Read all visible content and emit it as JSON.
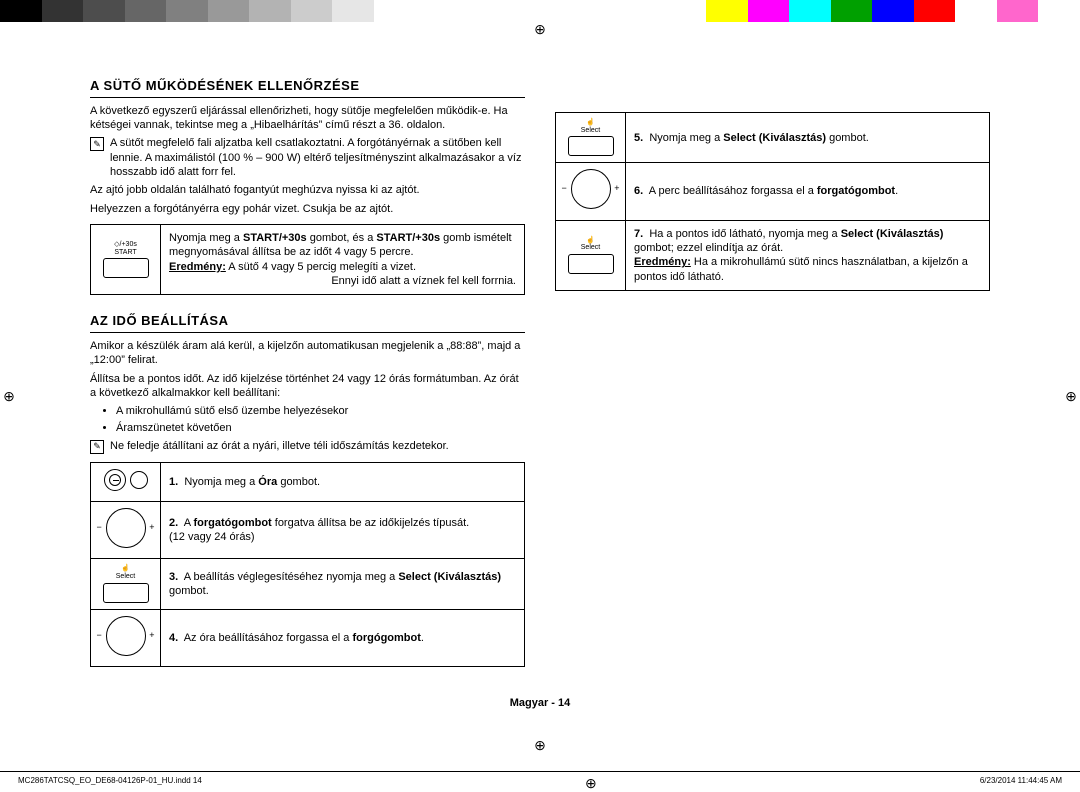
{
  "colorbar": [
    "#000000",
    "#333333",
    "#4d4d4d",
    "#666666",
    "#808080",
    "#999999",
    "#b3b3b3",
    "#cccccc",
    "#e6e6e6",
    "#ffffff",
    "#ffffff",
    "#ffffff",
    "#ffffff",
    "#ffffff",
    "#ffffff",
    "#ffffff",
    "#ffffff",
    "#ffff00",
    "#ff00ff",
    "#00ffff",
    "#00a000",
    "#0000ff",
    "#ff0000",
    "#ffffff",
    "#ff66cc",
    "#ffffff"
  ],
  "reg_glyph": "⊕",
  "section1": {
    "heading": "A SÜTŐ MŰKÖDÉSÉNEK ELLENŐRZÉSE",
    "p1": "A következő egyszerű eljárással ellenőrizheti, hogy sütője megfelelően működik-e. Ha kétségei vannak, tekintse meg a „Hibaelhárítás” című részt a 36. oldalon.",
    "note1": "A sütőt megfelelő fali aljzatba kell csatlakoztatni. A forgótányérnak a sütőben kell lennie. A maximálistól (100 % – 900 W) eltérő teljesítményszint alkalmazásakor a víz hosszabb idő alatt forr fel.",
    "p2": "Az ajtó jobb oldalán található fogantyút meghúzva nyissa ki az ajtót.",
    "p3": "Helyezzen a forgótányérra egy pohár vizet. Csukja be az ajtót.",
    "step_icon_labels": {
      "top": "◇/+30s",
      "bottom": "START"
    },
    "step_text_a": "Nyomja meg a ",
    "step_bold1": "START/+30s",
    "step_text_b": " gombot, és a ",
    "step_bold2": "START/+30s",
    "step_text_c": " gomb ismételt megnyomásával állítsa be az időt 4 vagy 5 percre.",
    "step_res_label": "Eredmény:",
    "step_res_text": " A sütő 4 vagy 5 percig melegíti a vizet.",
    "step_tail": "Ennyi idő alatt a víznek fel kell forrnia."
  },
  "section2": {
    "heading": "AZ IDŐ BEÁLLÍTÁSA",
    "p1": "Amikor a készülék áram alá kerül, a kijelzőn automatikusan megjelenik a „88:88”, majd a „12:00” felirat.",
    "p2": "Állítsa be a pontos időt. Az idő kijelzése történhet 24 vagy 12 órás formátumban. Az órát a következő alkalmakkor kell beállítani:",
    "b1": "A mikrohullámú sütő első üzembe helyezésekor",
    "b2": "Áramszünetet követően",
    "note": "Ne feledje átállítani az órát a nyári, illetve téli időszámítás kezdetekor.",
    "steps": [
      {
        "n": "1.",
        "a": "Nyomja meg a ",
        "bold": "Óra",
        "b": " gombot."
      },
      {
        "n": "2.",
        "a": "A ",
        "bold": "forgatógombot",
        "b": " forgatva állítsa be az időkijelzés típusát.",
        "c": "(12 vagy 24 órás)"
      },
      {
        "n": "3.",
        "a": "A beállítás véglegesítéséhez nyomja meg a ",
        "bold": "Select (Kiválasztás)",
        "b": " gombot."
      },
      {
        "n": "4.",
        "a": "Az óra beállításához forgassa el a ",
        "bold": "forgógombot",
        "b": "."
      }
    ],
    "sel_label": "Select"
  },
  "right_steps": [
    {
      "n": "5.",
      "a": "Nyomja meg a ",
      "bold": "Select (Kiválasztás)",
      "b": " gombot."
    },
    {
      "n": "6.",
      "a": "A perc beállításához forgassa el a ",
      "bold": "forgatógombot",
      "b": "."
    },
    {
      "n": "7.",
      "a": "Ha a pontos idő látható, nyomja meg a ",
      "bold": "Select (Kiválasztás)",
      "b": " gombot; ezzel elindítja az órát.",
      "res_label": "Eredmény:",
      "res": " Ha a mikrohullámú sütő nincs használatban, a kijelzőn a pontos idő látható."
    }
  ],
  "sel_label": "Select",
  "footer_center": "Magyar - 14",
  "footer_left": "MC286TATCSQ_EO_DE68-04126P-01_HU.indd   14",
  "footer_right": "6/23/2014   11:44:45 AM"
}
